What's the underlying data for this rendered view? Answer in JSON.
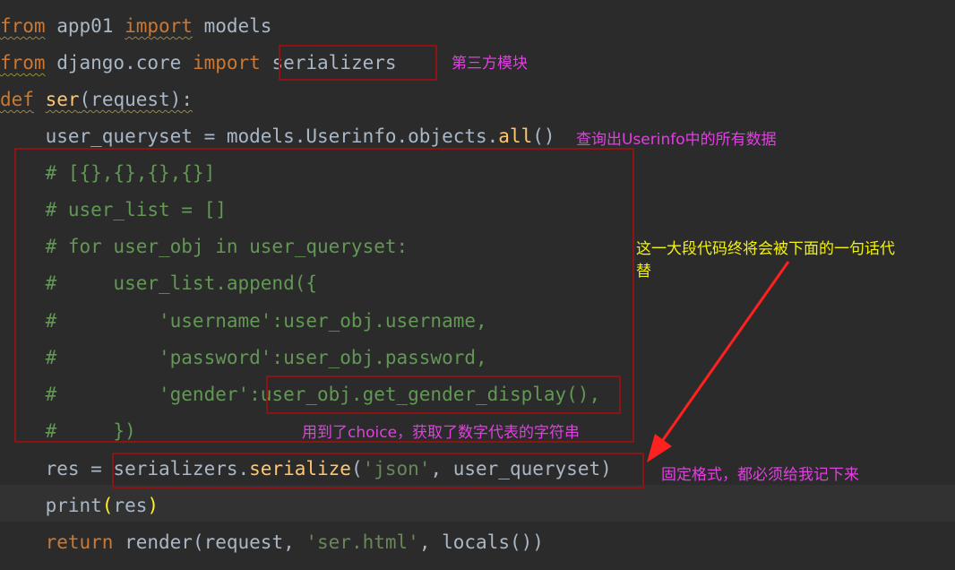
{
  "code": {
    "l1": {
      "from": "from",
      "mod": " app01 ",
      "import": "import",
      "rest": " models"
    },
    "l2": {
      "from": "from",
      "mod": " django.core ",
      "import": "import",
      "rest": " serializers"
    },
    "l3": {
      "def": "def",
      "name": "ser",
      "args": "(request):"
    },
    "l4": {
      "pre": "    user_queryset = models.Userinfo.objects.",
      "all": "all",
      "post": "()"
    },
    "l5": "    # [{},{},{},{}]",
    "l6": "    # user_list = []",
    "l7": "    # for user_obj in user_queryset:",
    "l8": "    #     user_list.append({",
    "l9": "    #         'username':user_obj.username,",
    "l10": "    #         'password':user_obj.password,",
    "l11": "    #         'gender':user_obj.get_gender_display(),",
    "l12": "    #     })",
    "l13": {
      "pre": "    res = serializers.",
      "fn": "serialize",
      "open": "(",
      "str": "'json'",
      "rest": ", user_queryset)"
    },
    "l14": {
      "pre": "    print",
      "open": "(",
      "mid": "res",
      "close": ")"
    },
    "l15": {
      "ret": "    return",
      "pre": " render(request, ",
      "str": "'ser.html'",
      "rest": ", locals())"
    }
  },
  "annotations": {
    "third_party": "第三方模块",
    "query_all": "查询出Userinfo中的所有数据",
    "replaced_line1": "这一大段代码终将会被下面的一句话代",
    "replaced_line2": "替",
    "choice_note": "用到了choice，获取了数字代表的字符串",
    "fixed_format": "固定格式，都必须给我记下来"
  },
  "colors": {
    "background": "#2b2b2b",
    "keyword": "#cc7832",
    "function": "#ffc66d",
    "comment": "#808080",
    "string": "#6a8759",
    "annotation_magenta": "#e040e0",
    "annotation_yellow": "#f2f20f",
    "box_red": "#8b1515",
    "arrow_red": "#ff2020"
  }
}
